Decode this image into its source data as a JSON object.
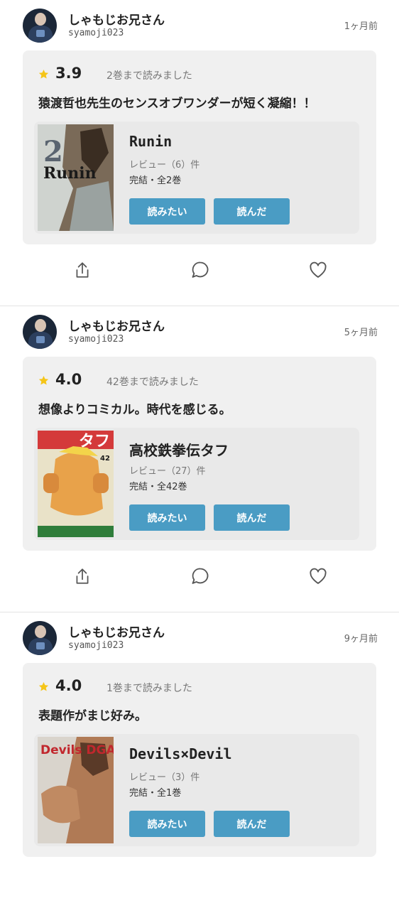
{
  "colors": {
    "accent": "#4a9cc4",
    "star": "#f5c518",
    "card": "#f0f0f0"
  },
  "posts": [
    {
      "user_name": "しゃもじお兄さん",
      "user_id": "syamoji023",
      "time": "1ヶ月前",
      "rating": "3.9",
      "progress": "2巻まで読みました",
      "review": "猿渡哲也先生のセンスオブワンダーが短く凝縮！！",
      "book": {
        "title": "Runin",
        "review_count": "レビュー（6）件",
        "status": "完結・全2巻",
        "cover_text": "Runin",
        "volume": "2"
      },
      "buttons": {
        "want": "読みたい",
        "read": "読んだ"
      }
    },
    {
      "user_name": "しゃもじお兄さん",
      "user_id": "syamoji023",
      "time": "5ヶ月前",
      "rating": "4.0",
      "progress": "42巻まで読みました",
      "review": "想像よりコミカル。時代を感じる。",
      "book": {
        "title": "高校鉄拳伝タフ",
        "review_count": "レビュー（27）件",
        "status": "完結・全42巻",
        "cover_text": "タフ",
        "volume": "42"
      },
      "buttons": {
        "want": "読みたい",
        "read": "読んだ"
      }
    },
    {
      "user_name": "しゃもじお兄さん",
      "user_id": "syamoji023",
      "time": "9ヶ月前",
      "rating": "4.0",
      "progress": "1巻まで読みました",
      "review": "表題作がまじ好み。",
      "book": {
        "title": "Devils×Devil",
        "review_count": "レビュー（3）件",
        "status": "完結・全1巻",
        "cover_text": "Devils DGAJI",
        "volume": ""
      },
      "buttons": {
        "want": "読みたい",
        "read": "読んだ"
      }
    }
  ],
  "icons": {
    "share": "share-icon",
    "comment": "comment-icon",
    "like": "heart-icon",
    "star": "star-icon"
  }
}
